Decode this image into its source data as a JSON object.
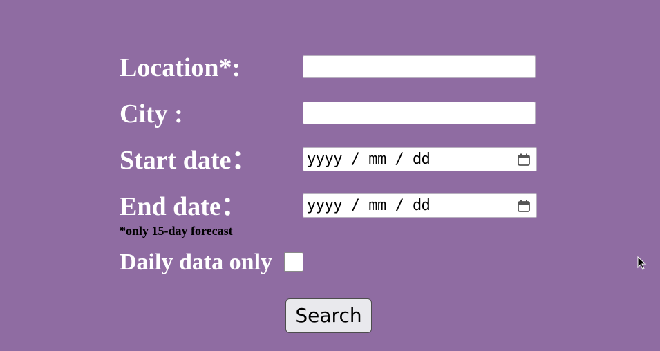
{
  "form": {
    "location_label": "Location*:",
    "city_label": "City :",
    "start_date_label": "Start date：",
    "end_date_label": "End date：",
    "start_date_placeholder": "yyyy / mm / dd",
    "end_date_placeholder": "yyyy / mm / dd",
    "forecast_note": "*only 15-day forecast",
    "daily_label": "Daily data only",
    "search_label": "Search"
  },
  "icons": {
    "calendar": "calendar-icon",
    "cursor": "mouse-cursor-icon"
  },
  "colors": {
    "background": "#8f6ca2",
    "label_text": "#ffffff",
    "note_text": "#000000",
    "button_bg": "#e9e9ed"
  }
}
